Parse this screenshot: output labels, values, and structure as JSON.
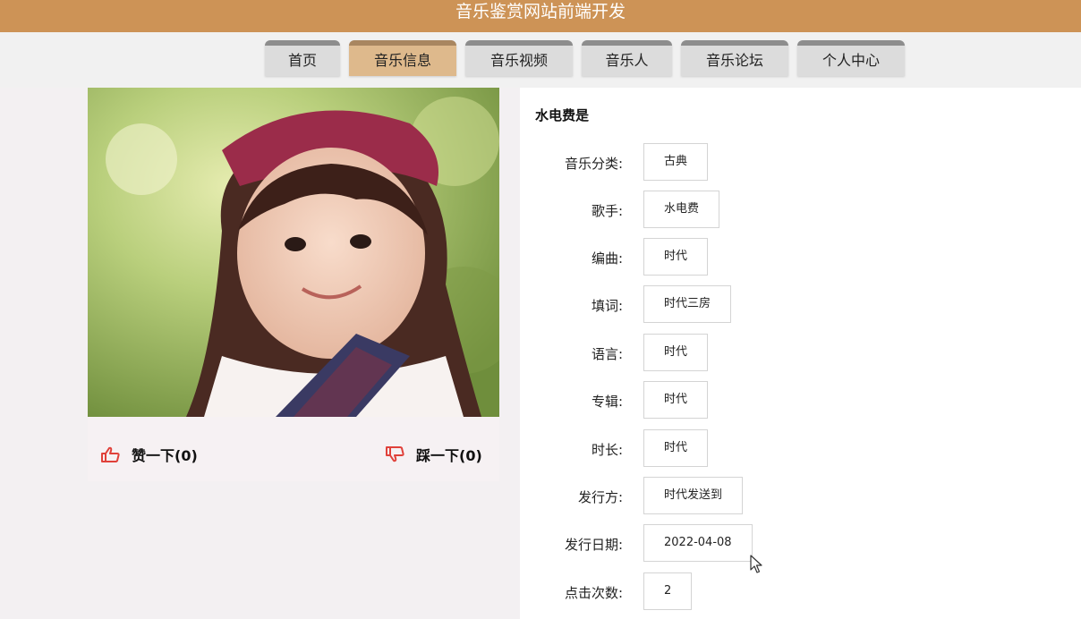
{
  "header": {
    "site_title": "音乐鉴赏网站前端开发"
  },
  "nav": {
    "tabs": [
      {
        "label": "首页",
        "active": false
      },
      {
        "label": "音乐信息",
        "active": true
      },
      {
        "label": "音乐视频",
        "active": false
      },
      {
        "label": "音乐人",
        "active": false
      },
      {
        "label": "音乐论坛",
        "active": false
      },
      {
        "label": "个人中心",
        "active": false
      }
    ]
  },
  "song": {
    "title": "水电费是",
    "fields": [
      {
        "label": "音乐分类:",
        "value": "古典"
      },
      {
        "label": "歌手:",
        "value": "水电费"
      },
      {
        "label": "编曲:",
        "value": "时代"
      },
      {
        "label": "填词:",
        "value": "时代三房"
      },
      {
        "label": "语言:",
        "value": "时代"
      },
      {
        "label": "专辑:",
        "value": "时代"
      },
      {
        "label": "时长:",
        "value": "时代"
      },
      {
        "label": "发行方:",
        "value": "时代发送到"
      },
      {
        "label": "发行日期:",
        "value": "2022-04-08"
      },
      {
        "label": "点击次数:",
        "value": "2"
      }
    ]
  },
  "actions": {
    "like_label": "赞一下(0)",
    "dislike_label": "踩一下(0)"
  },
  "colors": {
    "header_bg": "#cd9356",
    "active_tab": "#deb98c",
    "thumb_icon": "#e0413a"
  }
}
